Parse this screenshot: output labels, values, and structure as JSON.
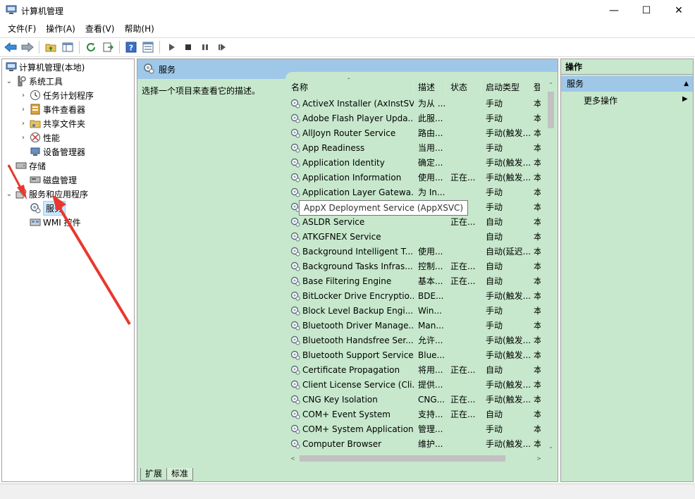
{
  "window": {
    "title": "计算机管理",
    "min_glyph": "—",
    "max_glyph": "☐",
    "close_glyph": "✕"
  },
  "menu": [
    "文件(F)",
    "操作(A)",
    "查看(V)",
    "帮助(H)"
  ],
  "toolbar_icons": [
    "back-icon",
    "forward-icon",
    "up-folder-icon",
    "show-hide-tree-icon",
    "refresh-icon",
    "export-list-icon",
    "help-icon",
    "properties-icon",
    "start-service-icon",
    "stop-service-icon",
    "pause-service-icon",
    "resume-service-icon"
  ],
  "tree": [
    {
      "label": "计算机管理(本地)",
      "caret": "",
      "level": 0,
      "icon": "computer-management-icon"
    },
    {
      "label": "系统工具",
      "caret": "⌄",
      "level": 1,
      "icon": "system-tools-icon"
    },
    {
      "label": "任务计划程序",
      "caret": "›",
      "level": 2,
      "icon": "task-scheduler-icon"
    },
    {
      "label": "事件查看器",
      "caret": "›",
      "level": 2,
      "icon": "event-viewer-icon"
    },
    {
      "label": "共享文件夹",
      "caret": "›",
      "level": 2,
      "icon": "shared-folders-icon"
    },
    {
      "label": "性能",
      "caret": "›",
      "level": 2,
      "icon": "performance-icon"
    },
    {
      "label": "设备管理器",
      "caret": "",
      "level": 2,
      "icon": "device-manager-icon"
    },
    {
      "label": "存储",
      "caret": "⌄",
      "level": 1,
      "icon": "storage-icon"
    },
    {
      "label": "磁盘管理",
      "caret": "",
      "level": 2,
      "icon": "disk-management-icon"
    },
    {
      "label": "服务和应用程序",
      "caret": "⌄",
      "level": 1,
      "icon": "services-apps-icon"
    },
    {
      "label": "服务",
      "caret": "",
      "level": 2,
      "icon": "services-icon",
      "selected": true
    },
    {
      "label": "WMI 控件",
      "caret": "",
      "level": 2,
      "icon": "wmi-control-icon"
    }
  ],
  "middle": {
    "header": "服务",
    "description_prompt": "选择一个项目来查看它的描述。",
    "columns": {
      "name": "名称",
      "desc": "描述",
      "status": "状态",
      "startup": "启动类型",
      "logon": "登"
    },
    "sort_glyph": "^",
    "services": [
      {
        "name": "ActiveX Installer (AxInstSV)",
        "desc": "为从 ...",
        "status": "",
        "startup": "手动",
        "logon": "本"
      },
      {
        "name": "Adobe Flash Player Upda...",
        "desc": "此服...",
        "status": "",
        "startup": "手动",
        "logon": "本"
      },
      {
        "name": "AllJoyn Router Service",
        "desc": "路由...",
        "status": "",
        "startup": "手动(触发...",
        "logon": "本"
      },
      {
        "name": "App Readiness",
        "desc": "当用...",
        "status": "",
        "startup": "手动",
        "logon": "本"
      },
      {
        "name": "Application Identity",
        "desc": "确定...",
        "status": "",
        "startup": "手动(触发...",
        "logon": "本"
      },
      {
        "name": "Application Information",
        "desc": "使用...",
        "status": "正在...",
        "startup": "手动(触发...",
        "logon": "本"
      },
      {
        "name": "Application Layer Gatewa...",
        "desc": "为 In...",
        "status": "",
        "startup": "手动",
        "logon": "本"
      },
      {
        "name": "AppX Deployment Servi...",
        "desc": "为部...",
        "status": "",
        "startup": "手动",
        "logon": "本"
      },
      {
        "name": "ASLDR Service",
        "desc": "",
        "status": "正在...",
        "startup": "自动",
        "logon": "本"
      },
      {
        "name": "ATKGFNEX Service",
        "desc": "",
        "status": "",
        "startup": "自动",
        "logon": "本"
      },
      {
        "name": "Background Intelligent T...",
        "desc": "使用...",
        "status": "",
        "startup": "自动(延迟...",
        "logon": "本"
      },
      {
        "name": "Background Tasks Infras...",
        "desc": "控制...",
        "status": "正在...",
        "startup": "自动",
        "logon": "本"
      },
      {
        "name": "Base Filtering Engine",
        "desc": "基本...",
        "status": "正在...",
        "startup": "自动",
        "logon": "本"
      },
      {
        "name": "BitLocker Drive Encryptio...",
        "desc": "BDE...",
        "status": "",
        "startup": "手动(触发...",
        "logon": "本"
      },
      {
        "name": "Block Level Backup Engi...",
        "desc": "Win...",
        "status": "",
        "startup": "手动",
        "logon": "本"
      },
      {
        "name": "Bluetooth Driver Manage...",
        "desc": "Man...",
        "status": "",
        "startup": "手动",
        "logon": "本"
      },
      {
        "name": "Bluetooth Handsfree Ser...",
        "desc": "允许...",
        "status": "",
        "startup": "手动(触发...",
        "logon": "本"
      },
      {
        "name": "Bluetooth Support Service",
        "desc": "Blue...",
        "status": "",
        "startup": "手动(触发...",
        "logon": "本"
      },
      {
        "name": "Certificate Propagation",
        "desc": "将用...",
        "status": "正在...",
        "startup": "自动",
        "logon": "本"
      },
      {
        "name": "Client License Service (Cli...",
        "desc": "提供...",
        "status": "",
        "startup": "手动(触发...",
        "logon": "本"
      },
      {
        "name": "CNG Key Isolation",
        "desc": "CNG...",
        "status": "正在...",
        "startup": "手动(触发...",
        "logon": "本"
      },
      {
        "name": "COM+ Event System",
        "desc": "支持...",
        "status": "正在...",
        "startup": "自动",
        "logon": "本"
      },
      {
        "name": "COM+ System Application",
        "desc": "管理...",
        "status": "",
        "startup": "手动",
        "logon": "本"
      },
      {
        "name": "Computer Browser",
        "desc": "维护...",
        "status": "",
        "startup": "手动(触发...",
        "logon": "本"
      }
    ],
    "tooltip": "AppX Deployment Service (AppXSVC)",
    "tabs": [
      "扩展",
      "标准"
    ],
    "active_tab": "标准",
    "scroll_up": "⌃",
    "scroll_down": "⌄",
    "scroll_left": "<",
    "scroll_right": ">"
  },
  "actions": {
    "title": "操作",
    "section": "服务",
    "collapse_glyph": "▲",
    "more": "更多操作",
    "more_arrow": "▶"
  },
  "colors": {
    "pane_bg": "#c7e8cc",
    "header_bg": "#9fc7e8",
    "arrow_red": "#e8382e"
  }
}
